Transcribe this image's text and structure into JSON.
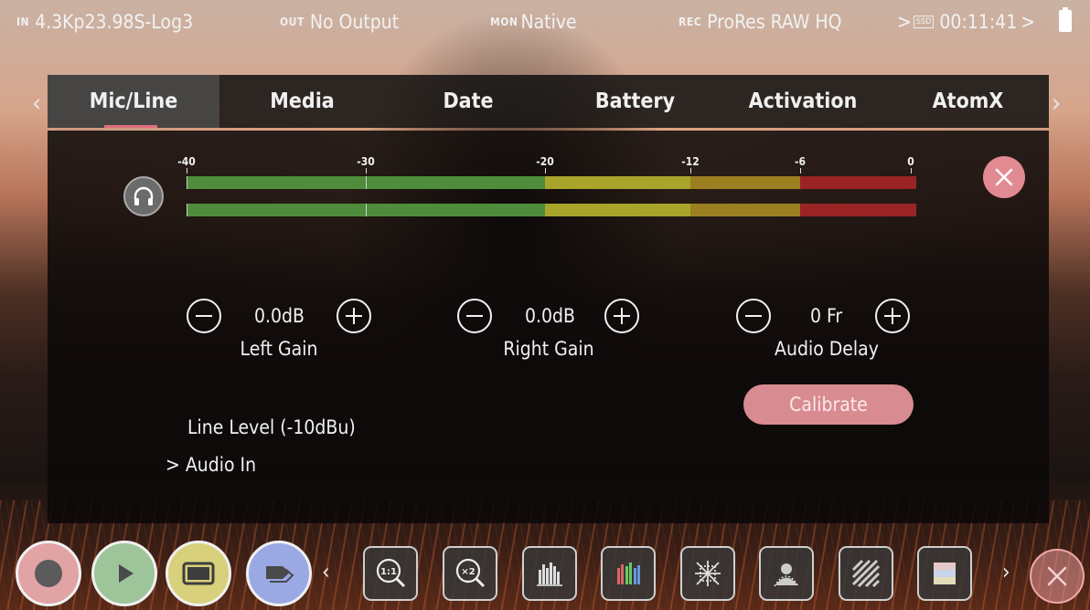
{
  "status_bar": {
    "in_tag": "IN",
    "in_value": "4.3Kp23.98S-Log3",
    "out_tag": "OUT",
    "out_value": "No Output",
    "mon_tag": "MON",
    "mon_value": "Native",
    "rec_tag": "REC",
    "rec_value": "ProRes RAW HQ",
    "media_chevron": ">",
    "media_label": "SSD",
    "timecode": "00:11:41",
    "timecode_chevron": ">",
    "battery_icon": "battery-full-icon"
  },
  "tabs": [
    {
      "label": "Mic/Line",
      "active": true
    },
    {
      "label": "Media",
      "active": false
    },
    {
      "label": "Date",
      "active": false
    },
    {
      "label": "Battery",
      "active": false
    },
    {
      "label": "Activation",
      "active": false
    },
    {
      "label": "AtomX",
      "active": false
    }
  ],
  "tab_arrows": {
    "left": "‹",
    "right": "›"
  },
  "meter": {
    "scale": [
      "-40",
      "-30",
      "-20",
      "-12",
      "-6",
      "0"
    ],
    "channels": 2,
    "colors": {
      "green": "#4f8c3c",
      "yellow": "#a9a52a",
      "olive": "#9c7f20",
      "red": "#9a2424"
    }
  },
  "controls": {
    "left_gain": {
      "value": "0.0dB",
      "label": "Left Gain"
    },
    "right_gain": {
      "value": "0.0dB",
      "label": "Right Gain"
    },
    "audio_delay": {
      "value": "0 Fr",
      "label": "Audio Delay"
    },
    "calibrate_label": "Calibrate",
    "line_level": "Line Level (-10dBu)",
    "audio_in": "> Audio In"
  },
  "toolbar": {
    "record_color": "#e2a3a5",
    "play_color": "#9ec49a",
    "monitor_color": "#d8d07a",
    "tags_color": "#9aa9e4",
    "nav_left": "‹",
    "nav_right": "›",
    "tools": [
      {
        "name": "zoom-1-1-icon",
        "text": "1:1"
      },
      {
        "name": "zoom-x2-icon",
        "text": "×2"
      },
      {
        "name": "waveform-icon",
        "text": ""
      },
      {
        "name": "vectorscope-icon",
        "text": ""
      },
      {
        "name": "focus-peaking-icon",
        "text": ""
      },
      {
        "name": "false-color-icon",
        "text": ""
      },
      {
        "name": "zebra-icon",
        "text": ""
      },
      {
        "name": "lut-icon",
        "text": ""
      }
    ]
  }
}
